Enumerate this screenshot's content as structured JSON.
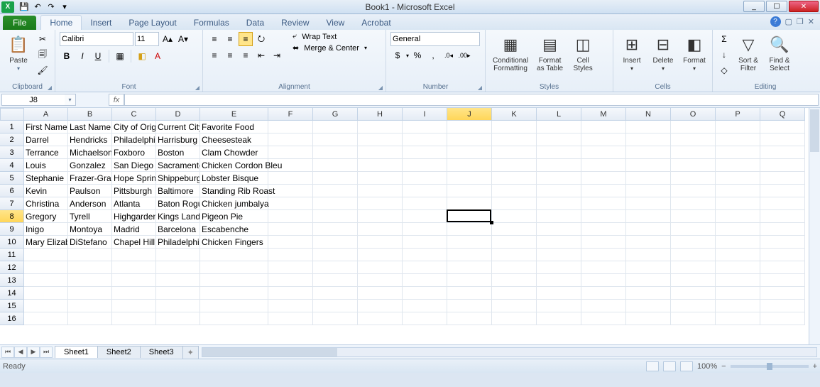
{
  "app": {
    "title": "Book1 - Microsoft Excel"
  },
  "qat": {
    "save": "💾",
    "undo": "↶",
    "redo": "↷"
  },
  "win": {
    "min": "_",
    "max": "☐",
    "close": "✕"
  },
  "tabs": {
    "file": "File",
    "home": "Home",
    "insert": "Insert",
    "pagelayout": "Page Layout",
    "formulas": "Formulas",
    "data": "Data",
    "review": "Review",
    "view": "View",
    "acrobat": "Acrobat"
  },
  "ribbon": {
    "clipboard": {
      "paste": "Paste",
      "label": "Clipboard"
    },
    "font": {
      "name": "Calibri",
      "size": "11",
      "label": "Font",
      "bold": "B",
      "italic": "I",
      "underline": "U"
    },
    "alignment": {
      "wrap": "Wrap Text",
      "merge": "Merge & Center",
      "label": "Alignment"
    },
    "number": {
      "format": "General",
      "label": "Number",
      "cur": "$",
      "pct": "%",
      "comma": ",",
      "dec_inc": "←.0",
      "dec_dec": ".00→"
    },
    "styles": {
      "cond": "Conditional\nFormatting",
      "table": "Format\nas Table",
      "cell": "Cell\nStyles",
      "label": "Styles"
    },
    "cells": {
      "insert": "Insert",
      "delete": "Delete",
      "format": "Format",
      "label": "Cells"
    },
    "editing": {
      "sort": "Sort &\nFilter",
      "find": "Find &\nSelect",
      "label": "Editing",
      "sum": "Σ",
      "fill": "↓",
      "clear": "◇"
    }
  },
  "namebox": "J8",
  "fx": "fx",
  "columns": [
    "A",
    "B",
    "C",
    "D",
    "E",
    "F",
    "G",
    "H",
    "I",
    "J",
    "K",
    "L",
    "M",
    "N",
    "O",
    "P",
    "Q"
  ],
  "selected_col": "J",
  "selected_row": 8,
  "data": {
    "headers": [
      "First Name",
      "Last Name",
      "City of Origin",
      "Current City",
      "Favorite Food"
    ],
    "rows": [
      [
        "Darrel",
        "Hendricks",
        "Philadelphia",
        "Harrisburg",
        "Cheesesteak"
      ],
      [
        "Terrance",
        "Michaelson",
        "Foxboro",
        "Boston",
        "Clam Chowder"
      ],
      [
        "Louis",
        "Gonzalez",
        "San Diego",
        "Sacramento",
        "Chicken Cordon Bleu"
      ],
      [
        "Stephanie",
        "Frazer-Grant",
        "Hope Springs",
        "Shippeburg",
        "Lobster Bisque"
      ],
      [
        "Kevin",
        "Paulson",
        "Pittsburgh",
        "Baltimore",
        "Standing Rib Roast"
      ],
      [
        "Christina",
        "Anderson",
        "Atlanta",
        "Baton Rogue",
        "Chicken jumbalya"
      ],
      [
        "Gregory",
        "Tyrell",
        "Highgarden",
        "Kings Landing",
        "Pigeon Pie"
      ],
      [
        "Inigo",
        "Montoya",
        "Madrid",
        "Barcelona",
        "Escabenche"
      ],
      [
        "Mary Elizabeth",
        "DiStefano",
        "Chapel Hill",
        "Philadelphia",
        "Chicken Fingers"
      ]
    ]
  },
  "sheets": [
    "Sheet1",
    "Sheet2",
    "Sheet3"
  ],
  "status": {
    "ready": "Ready",
    "zoom": "100%"
  }
}
